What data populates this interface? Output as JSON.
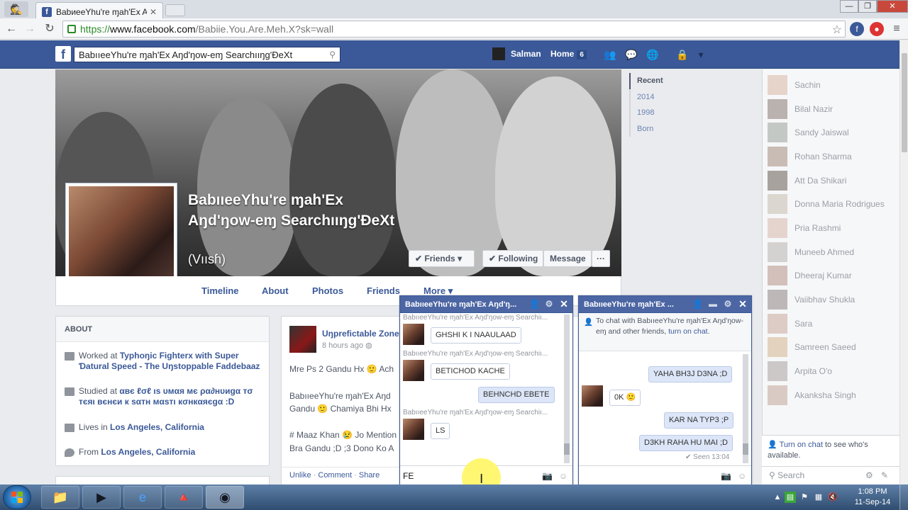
{
  "browser": {
    "tab_title": "BabиeeYhu're ɱah'Ex Aŋd",
    "url_scheme": "https://",
    "url_host": "www.facebook.com",
    "url_path": "/Babiie.You.Are.Meh.X?sk=wall"
  },
  "fb": {
    "search_value": "BabııeeYhu're ɱah'Ex Aŋd'ŋow-eɱ Searchııŋg'ÐeXt",
    "user_name": "Salman",
    "home_label": "Home",
    "home_count": "6"
  },
  "profile": {
    "name": "BabııeeYhu're ɱah'Ex Aŋd'ŋow-eɱ Searchııŋg'ÐeXt",
    "alt_name": "(Vıısɦ)",
    "buttons": {
      "friends": "Friends",
      "following": "Following",
      "message": "Message",
      "more": "···"
    },
    "tabs": [
      "Timeline",
      "About",
      "Photos",
      "Friends",
      "More"
    ]
  },
  "timeline_nav": [
    "Recent",
    "2014",
    "1998",
    "Born"
  ],
  "about": {
    "header": "ABOUT",
    "work_prefix": "Worked at ",
    "work_link": "Typhoŋic Fighterx with Super Ɗatural Speed - The Uŋstoppable Faddebaaz",
    "study_prefix": "Studied at ",
    "study_link": "αвє ℓσℓ ιѕ υмαя мє ρα∂нυиgα тσ тєяι вєнєи к ѕαтн мαѕтι кσнкαяєgα :D",
    "lives_prefix": "Lives in ",
    "lives_link": "Los Angeles, California",
    "from_prefix": "From ",
    "from_link": "Los Angeles, California"
  },
  "post": {
    "author": "Uŋprefictable Zone",
    "time": "8 hours ago",
    "line1": "Mre Ps 2 Gandu Hx 🙂 Ach",
    "line2": "BabııeeYhu're ɱah'Ex Aŋd",
    "line3": "Gandu 🙂 Chamiya Bhi Hx",
    "line4": "# Maaz Khan 😢 Jo Mention",
    "line5": "Bra Gandu ;D ;3 Dono Ko A",
    "actions": {
      "unlike": "Unlike",
      "comment": "Comment",
      "share": "Share"
    }
  },
  "chat1": {
    "title": "BabııeeYhu're ɱah'Ex Aŋd'ŋ...",
    "sender_label": "BabııeeYhu're ɱah'Ex Aŋd'ŋow-eɱ Searchiı...",
    "messages": [
      "GHSHI K I NAAULAAD",
      "BETICHOD KACHE",
      "BEHNCHD EBETE",
      "LS"
    ],
    "typing": "FE"
  },
  "chat2": {
    "title": "BabııeeYhu're ɱah'Ex ...",
    "notice": "To chat with BabııeeYhu're ɱah'Ex Aŋd'ŋow-eɱ and other friends, ",
    "notice_link": "turn on chat",
    "notice_end": ".",
    "messages": [
      "YAHA BH3J D3NA ;D",
      "0K 🙂",
      "KAR NA TYP3 ;P",
      "D3KH RAHA HU MAI ;D"
    ],
    "seen": "Seen 13:04"
  },
  "sidebar": {
    "friends": [
      "Sachin",
      "Bilal Nazir",
      "Sandy Jaiswal",
      "Rohan Sharma",
      "Att Da Shikari",
      "Donna Maria Rodrigues",
      "Pria Rashmi",
      "Muneeb Ahmed",
      "Dheeraj Kumar",
      "Vaiibhav Shukla",
      "Sara",
      "Samreen Saeed",
      "Arpita O'o",
      "Akanksha Singh"
    ],
    "turn_on_link": "Turn on chat",
    "turn_on_rest": " to see who's available.",
    "search_placeholder": "Search"
  },
  "taskbar": {
    "time": "1:08 PM",
    "date": "11-Sep-14"
  },
  "colors": {
    "fb_blue": "#3b5998",
    "chat_header": "#4c66a4"
  }
}
